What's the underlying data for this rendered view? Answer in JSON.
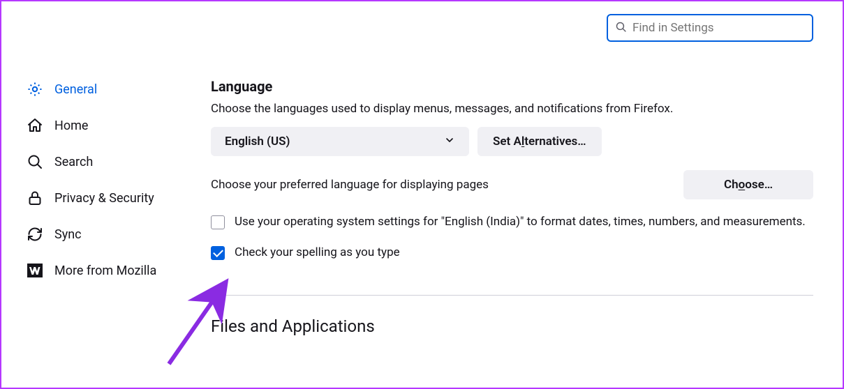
{
  "search": {
    "placeholder": "Find in Settings"
  },
  "sidebar": {
    "items": [
      {
        "label": "General"
      },
      {
        "label": "Home"
      },
      {
        "label": "Search"
      },
      {
        "label": "Privacy & Security"
      },
      {
        "label": "Sync"
      },
      {
        "label": "More from Mozilla"
      }
    ]
  },
  "language": {
    "heading": "Language",
    "desc": "Choose the languages used to display menus, messages, and notifications from Firefox.",
    "selected": "English (US)",
    "set_alt_prefix": "Set A",
    "set_alt_ul": "l",
    "set_alt_suffix": "ternatives…",
    "choose_desc": "Choose your preferred language for displaying pages",
    "choose_prefix": "Ch",
    "choose_ul": "o",
    "choose_suffix": "ose…",
    "os_format": "Use your operating system settings for \"English (India)\" to format dates, times, numbers, and measurements.",
    "spellcheck": "Check your spelling as you type"
  },
  "files": {
    "heading": "Files and Applications"
  }
}
